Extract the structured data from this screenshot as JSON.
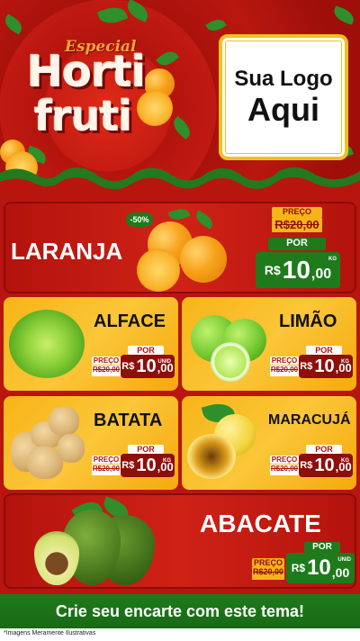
{
  "header": {
    "especial": "Especial",
    "horti": "Horti",
    "fruti": "fruti",
    "logo_line1": "Sua Logo",
    "logo_line2": "Aqui"
  },
  "products": {
    "laranja": {
      "name": "LARANJA",
      "discount": "-50%",
      "preco_label": "PREÇO",
      "old_price": "R$20,00",
      "por_label": "POR",
      "currency": "R$",
      "amount": "10",
      "cents": ",00",
      "unit": "KG"
    },
    "alface": {
      "name": "ALFACE",
      "preco_label": "PREÇO",
      "old_price": "R$20,00",
      "por_label": "POR",
      "currency": "R$",
      "amount": "10",
      "cents": ",00",
      "unit": "UNID"
    },
    "limao": {
      "name": "LIMÃO",
      "preco_label": "PREÇO",
      "old_price": "R$20,00",
      "por_label": "POR",
      "currency": "R$",
      "amount": "10",
      "cents": ",00",
      "unit": "KG"
    },
    "batata": {
      "name": "BATATA",
      "preco_label": "PREÇO",
      "old_price": "R$20,00",
      "por_label": "POR",
      "currency": "R$",
      "amount": "10",
      "cents": ",00",
      "unit": "KG"
    },
    "maracuja": {
      "name": "MARACUJÁ",
      "preco_label": "PREÇO",
      "old_price": "R$20,00",
      "por_label": "POR",
      "currency": "R$",
      "amount": "10",
      "cents": ",00",
      "unit": "KG"
    },
    "abacate": {
      "name": "ABACATE",
      "preco_label": "PREÇO",
      "old_price": "R$20,00",
      "por_label": "POR",
      "currency": "R$",
      "amount": "10",
      "cents": ",00",
      "unit": "UNID"
    }
  },
  "footer": {
    "cta": "Crie seu encarte com este tema!",
    "disclaimer": "*Imagens Meramente Ilustrativas"
  },
  "colors": {
    "red": "#b3130d",
    "dark_red": "#8e0e0a",
    "yellow": "#f7b418",
    "green": "#1f7a1c",
    "logo_border": "#f0c020"
  }
}
